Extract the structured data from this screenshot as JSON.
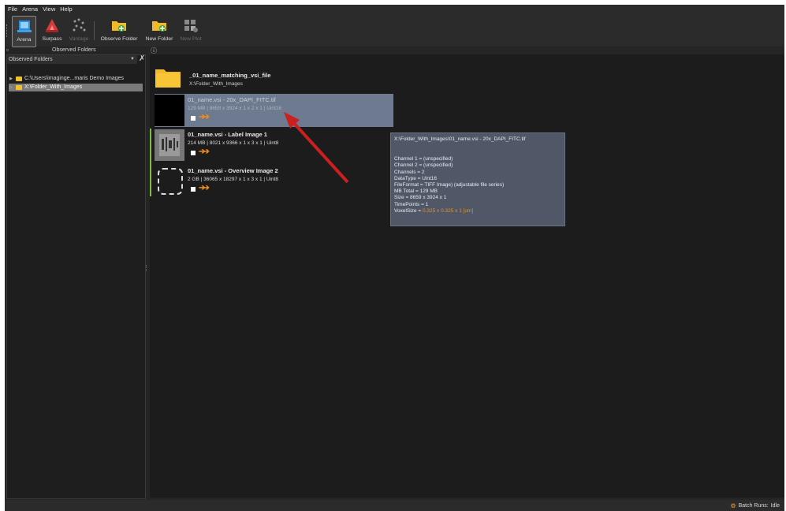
{
  "menu": [
    "File",
    "Arena",
    "View",
    "Help"
  ],
  "toolbar": {
    "arena": "Arena",
    "surpass": "Surpass",
    "vantage": "Vantage",
    "observe_folder": "Observe Folder",
    "new_folder": "New Folder",
    "new_plot": "New Plot"
  },
  "left_panel": {
    "header": "Observed Folders",
    "combo_value": "Observed Folders",
    "tree": [
      {
        "label": "C:\\Users\\imaginge...maris Demo Images",
        "selected": false
      },
      {
        "label": "X:\\Folder_With_Images",
        "selected": true
      }
    ]
  },
  "content": {
    "folder": {
      "title": "_01_name_matching_vsi_file",
      "path": "X:\\Folder_With_Images"
    },
    "files": [
      {
        "title": "01_name.vsi - 20x_DAPI_FITC.tif",
        "details": "129 MB | 8659 x 3924 x 1 x 2 x 1 | Uint16",
        "selected": true
      },
      {
        "title": "01_name.vsi - Label Image 1",
        "details": "214 MB | 8021 x 9366 x 1 x 3 x 1 | Uint8",
        "selected": false
      },
      {
        "title": "01_name.vsi - Overview Image 2",
        "details": "2 GB | 36065 x 18297 x 1 x 3 x 1 | Uint8",
        "selected": false
      }
    ]
  },
  "tooltip": {
    "path": "X:\\Folder_With_Images\\01_name.vsi - 20x_DAPI_FITC.tif",
    "lines": [
      "Channel 1 = (unspecified)",
      "Channel 2 = (unspecified)",
      "Channels = 2",
      "DataType = Uint16",
      "FileFormat = TIFF Image) (adjustable file series)",
      "MB Total = 129 MB",
      "Size = 8659 x 3924 x 1",
      "TimePoints = 1"
    ],
    "voxel_label": "VoxelSize = ",
    "voxel_value": "0.325 x 0.325 x 1 [um]"
  },
  "status": {
    "batch_runs": "Batch Runs:",
    "state": "Idle"
  },
  "colors": {
    "accent_orange": "#f08c1a",
    "selection": "#6e7a90",
    "annotation_arrow": "#cc1f1f",
    "green_marker": "#7cc242"
  }
}
